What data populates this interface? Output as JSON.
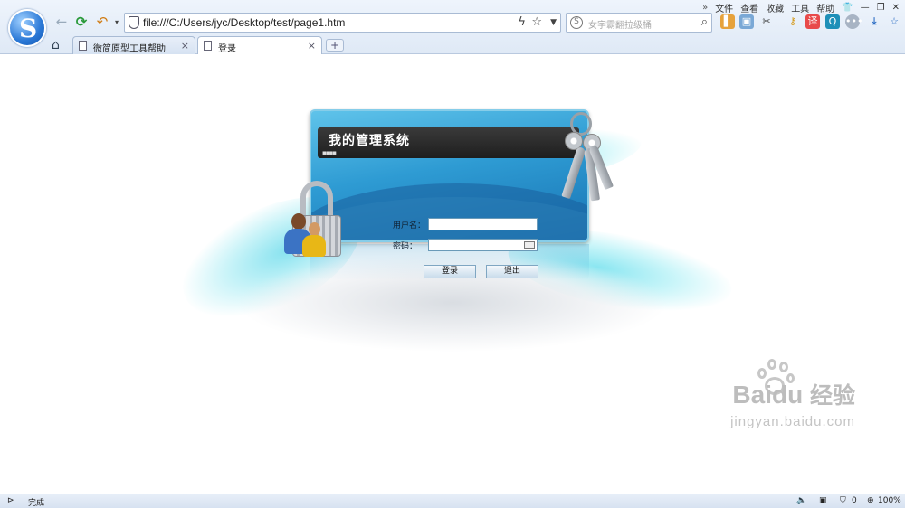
{
  "browser": {
    "logo": "S",
    "menu": [
      "文件",
      "查看",
      "收藏",
      "工具",
      "帮助"
    ],
    "address": "file:///C:/Users/jyc/Desktop/test/page1.htm",
    "search_placeholder": "女字霸翻拉级桶",
    "tabs": [
      {
        "label": "微简原型工具帮助",
        "active": false
      },
      {
        "label": "登录",
        "active": true
      }
    ],
    "newtab": "+"
  },
  "login": {
    "title": "我的管理系统",
    "username_label": "用户名：",
    "password_label": "密码：",
    "username_value": "",
    "password_value": "",
    "login_button": "登录",
    "exit_button": "退出"
  },
  "watermark": {
    "brand_latin": "Bai",
    "brand_du": "du",
    "brand_cn": "经验",
    "url": "jingyan.baidu.com"
  },
  "status": {
    "text": "完成",
    "shield_count": "0",
    "zoom": "100%"
  },
  "colors": {
    "panel": "#2e9bd3",
    "titlebar": "#1e1e1e",
    "chrome": "#dfe9f6"
  }
}
